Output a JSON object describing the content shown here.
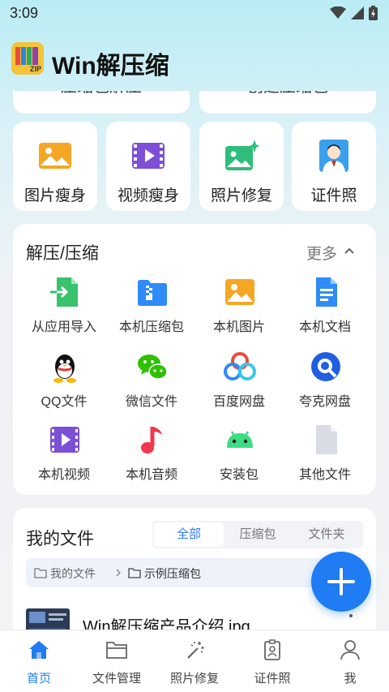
{
  "status_bar": {
    "time": "3:09"
  },
  "header": {
    "app_title": "Win解压缩",
    "logo_text": "ZIP"
  },
  "top_cards": {
    "left_label": "压缩包解压",
    "right_label": "创建压缩包"
  },
  "tools": [
    {
      "label": "图片瘦身",
      "icon": "image-icon"
    },
    {
      "label": "视频瘦身",
      "icon": "video-icon"
    },
    {
      "label": "照片修复",
      "icon": "photo-sparkle-icon"
    },
    {
      "label": "证件照",
      "icon": "id-photo-icon"
    }
  ],
  "decompress_panel": {
    "title": "解压/压缩",
    "more_label": "更多",
    "items": [
      {
        "label": "从应用导入",
        "icon": "import-app-icon"
      },
      {
        "label": "本机压缩包",
        "icon": "zip-folder-icon"
      },
      {
        "label": "本机图片",
        "icon": "image-icon"
      },
      {
        "label": "本机文档",
        "icon": "document-icon"
      },
      {
        "label": "QQ文件",
        "icon": "qq-icon"
      },
      {
        "label": "微信文件",
        "icon": "wechat-icon"
      },
      {
        "label": "百度网盘",
        "icon": "baidu-netdisk-icon"
      },
      {
        "label": "夸克网盘",
        "icon": "quark-netdisk-icon"
      },
      {
        "label": "本机视频",
        "icon": "video-icon"
      },
      {
        "label": "本机音频",
        "icon": "music-note-icon"
      },
      {
        "label": "安装包",
        "icon": "android-icon"
      },
      {
        "label": "其他文件",
        "icon": "file-icon"
      }
    ]
  },
  "my_files": {
    "title": "我的文件",
    "tabs": [
      {
        "label": "全部",
        "active": true
      },
      {
        "label": "压缩包",
        "active": false
      },
      {
        "label": "文件夹",
        "active": false
      }
    ],
    "breadcrumb": {
      "root": "我的文件",
      "current": "示例压缩包"
    },
    "file_name": "Win解压缩产品介绍.jpg"
  },
  "bottom_nav": [
    {
      "label": "首页",
      "icon": "home-icon",
      "active": true
    },
    {
      "label": "文件管理",
      "icon": "folder-icon",
      "active": false
    },
    {
      "label": "照片修复",
      "icon": "magic-wand-icon",
      "active": false
    },
    {
      "label": "证件照",
      "icon": "id-badge-icon",
      "active": false
    },
    {
      "label": "我",
      "icon": "person-icon",
      "active": false
    }
  ],
  "colors": {
    "accent": "#1f7cf3",
    "card_bg": "#ffffff",
    "page_bg_top": "#b9ecf4"
  }
}
